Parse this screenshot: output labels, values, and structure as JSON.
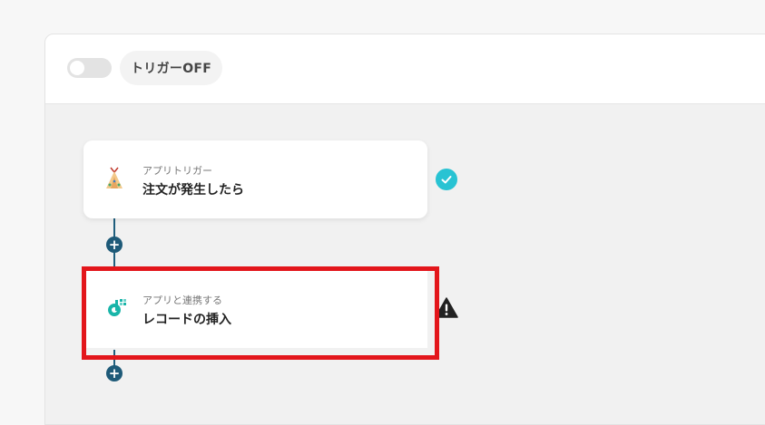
{
  "header": {
    "toggle_state": "off",
    "trigger_label": "トリガーOFF"
  },
  "steps": [
    {
      "subtitle": "アプリトリガー",
      "title": "注文が発生したら",
      "icon": "teepee-tent-icon",
      "status": "completed"
    },
    {
      "subtitle": "アプリと連携する",
      "title": "レコードの挿入",
      "icon": "app-logo-icon",
      "status": "warning"
    }
  ],
  "colors": {
    "accent_line": "#1f5f7e",
    "success": "#28c3d3",
    "warning": "#222222",
    "highlight": "#e3161b"
  }
}
